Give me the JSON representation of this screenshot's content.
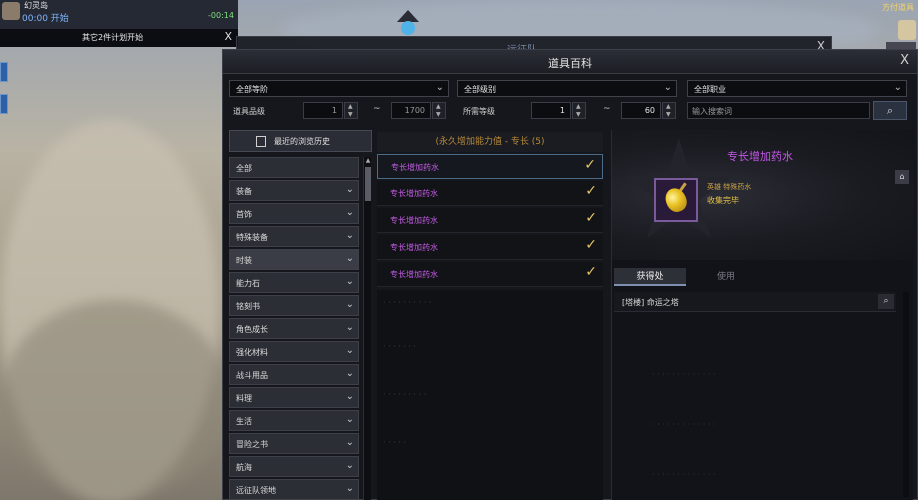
{
  "quest": {
    "title": "幻灵岛",
    "time": "00:00 开始",
    "countdown": "-00:14",
    "subtext": "其它2件计划开始",
    "close": "X"
  },
  "hud": {
    "label": "方付道具"
  },
  "bg_window": {
    "title": "远征队",
    "close": "X"
  },
  "window": {
    "title": "道具百科",
    "close": "X"
  },
  "filters": {
    "tier": "全部等阶",
    "grade": "全部级别",
    "class": "全部职业",
    "item_level_label": "道具品级",
    "item_level_min": "1",
    "item_level_max": "1700",
    "req_level_label": "所需等级",
    "req_level_min": "1",
    "req_level_max": "60",
    "tilde": "~",
    "search_placeholder": "输入搜索词"
  },
  "history_button": "最近的浏览历史",
  "categories": [
    {
      "label": "全部",
      "chevron": false
    },
    {
      "label": "装备",
      "chevron": true
    },
    {
      "label": "首饰",
      "chevron": true
    },
    {
      "label": "特殊装备",
      "chevron": true
    },
    {
      "label": "时装",
      "chevron": true
    },
    {
      "label": "能力石",
      "chevron": true
    },
    {
      "label": "铭刻书",
      "chevron": true
    },
    {
      "label": "角色成长",
      "chevron": true
    },
    {
      "label": "强化材料",
      "chevron": true
    },
    {
      "label": "战斗用品",
      "chevron": true
    },
    {
      "label": "料理",
      "chevron": true
    },
    {
      "label": "生活",
      "chevron": true
    },
    {
      "label": "冒险之书",
      "chevron": true
    },
    {
      "label": "航海",
      "chevron": true
    },
    {
      "label": "远征队领地",
      "chevron": true
    }
  ],
  "list": {
    "header": "(永久增加能力值 - 专长 (5)",
    "items": [
      {
        "label": "专长增加药水",
        "checked": true
      },
      {
        "label": "专长增加药水",
        "checked": true
      },
      {
        "label": "专长增加药水",
        "checked": true
      },
      {
        "label": "专长增加药水",
        "checked": true
      },
      {
        "label": "专长增加药水",
        "checked": true
      }
    ]
  },
  "detail": {
    "item_name": "专长增加药水",
    "grade": "英雄 特殊药水",
    "status": "收集完毕",
    "tabs": [
      "获得处",
      "使用"
    ],
    "source": "[塔楼] 命运之塔"
  },
  "colors": {
    "item_purple": "#c45ce6",
    "check_gold": "#e6c46a",
    "header_orange": "#b88a3a",
    "status_gold": "#e8c448"
  }
}
